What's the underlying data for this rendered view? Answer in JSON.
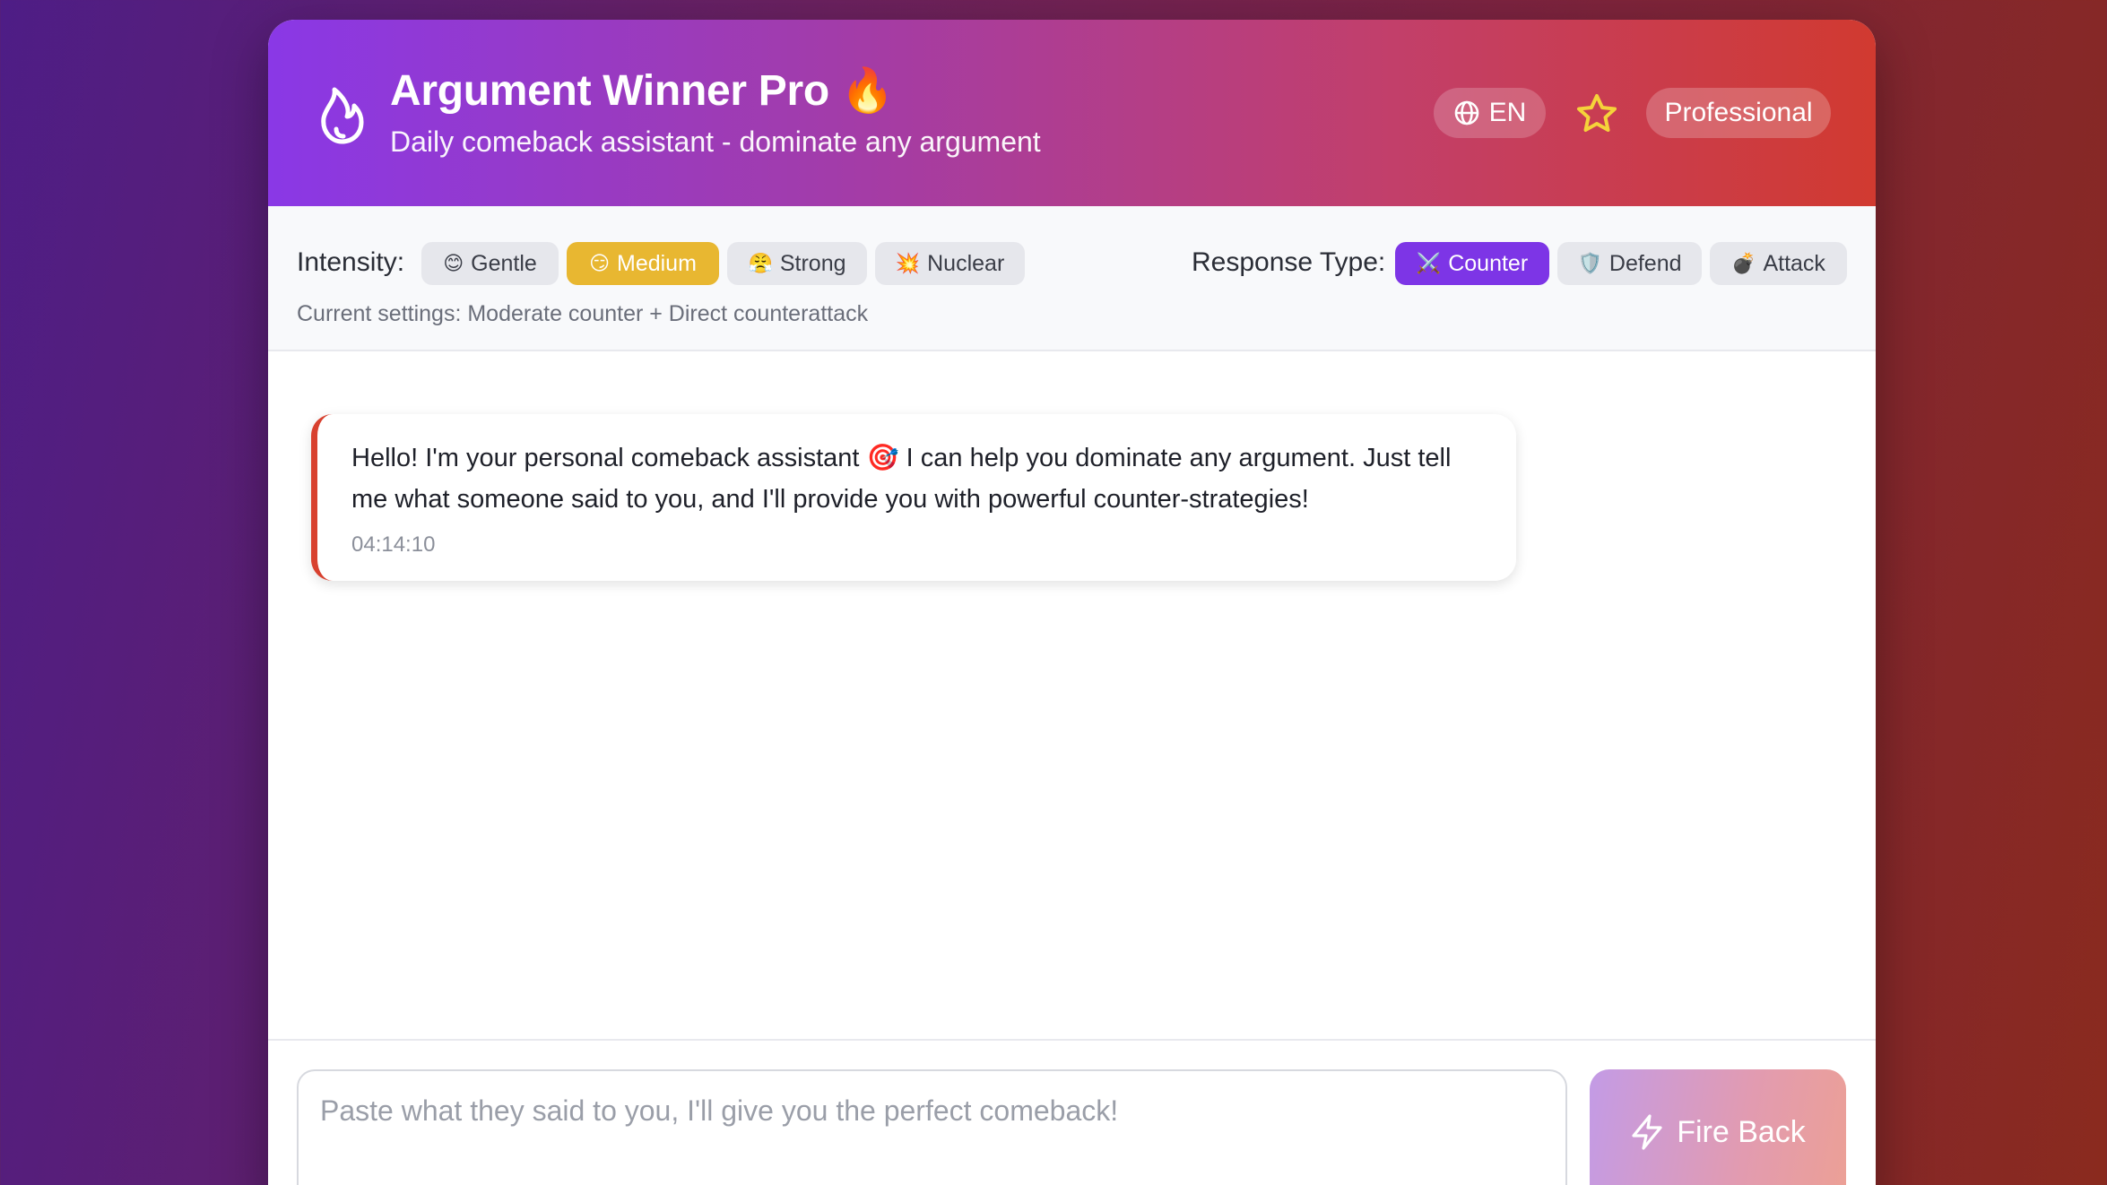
{
  "header": {
    "logo_icon": "flame-outline-icon",
    "title": "Argument Winner Pro 🔥",
    "subtitle": "Daily comeback assistant - dominate any argument",
    "language_label": "EN",
    "language_icon": "globe-icon",
    "favorite_icon": "star-icon",
    "plan_label": "Professional",
    "colors": {
      "gradient_start": "#8a38e6",
      "gradient_end": "#d13a30",
      "star": "#f5d33a"
    }
  },
  "settings": {
    "intensity_label": "Intensity:",
    "intensity_options": [
      {
        "emoji": "😊",
        "label": "Gentle",
        "active": false
      },
      {
        "emoji": "😏",
        "label": "Medium",
        "active": true
      },
      {
        "emoji": "😤",
        "label": "Strong",
        "active": false
      },
      {
        "emoji": "💥",
        "label": "Nuclear",
        "active": false
      }
    ],
    "response_type_label": "Response Type:",
    "response_options": [
      {
        "emoji": "⚔️",
        "label": "Counter",
        "active": true
      },
      {
        "emoji": "🛡️",
        "label": "Defend",
        "active": false
      },
      {
        "emoji": "💣",
        "label": "Attack",
        "active": false
      }
    ],
    "current_settings": "Current settings: Moderate counter + Direct counterattack",
    "colors": {
      "intensity_active": "#e8b731",
      "type_active": "#7d35e6"
    }
  },
  "chat": {
    "messages": [
      {
        "text": "Hello! I'm your personal comeback assistant 🎯 I can help you dominate any argument. Just tell me what someone said to you, and I'll provide you with powerful counter-strategies!",
        "time": "04:14:10",
        "accent_color": "#d8412f"
      }
    ]
  },
  "composer": {
    "placeholder": "Paste what they said to you, I'll give you the perfect comeback!",
    "value": "",
    "send_label": "Fire Back",
    "send_icon": "lightning-icon"
  }
}
